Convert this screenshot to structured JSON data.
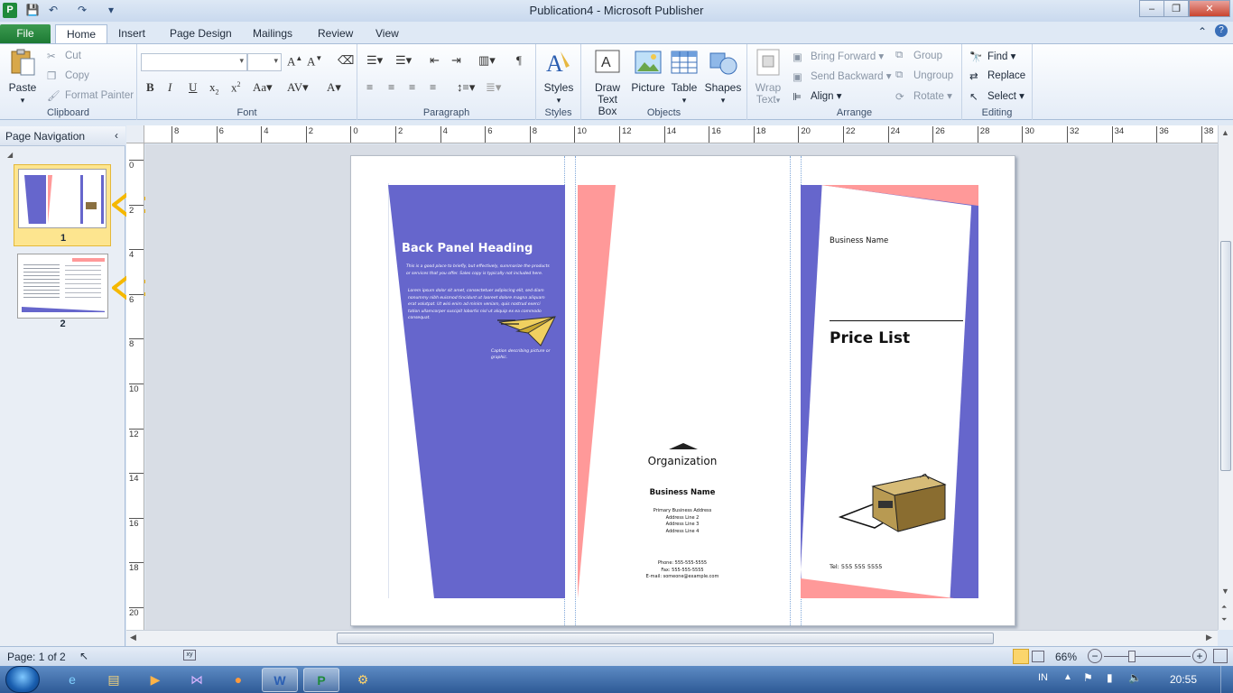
{
  "window": {
    "title": "Publication4  -  Microsoft Publisher",
    "min_label": "–",
    "max_label": "❐",
    "close_label": "✕"
  },
  "quick_access": {
    "save": "💾",
    "undo": "↶",
    "redo": "↷",
    "customize": "▾"
  },
  "tabs": [
    {
      "label": "File"
    },
    {
      "label": "Home"
    },
    {
      "label": "Insert"
    },
    {
      "label": "Page Design"
    },
    {
      "label": "Mailings"
    },
    {
      "label": "Review"
    },
    {
      "label": "View"
    }
  ],
  "ribbon": {
    "clipboard": {
      "label": "Clipboard",
      "paste": "Paste",
      "cut": "Cut",
      "copy": "Copy",
      "format_painter": "Format Painter"
    },
    "font": {
      "label": "Font"
    },
    "paragraph": {
      "label": "Paragraph"
    },
    "styles": {
      "label": "Styles",
      "styles_btn": "Styles"
    },
    "objects": {
      "label": "Objects",
      "draw_text_box_1": "Draw",
      "draw_text_box_2": "Text Box",
      "picture": "Picture",
      "table": "Table",
      "shapes": "Shapes"
    },
    "arrange": {
      "label": "Arrange",
      "wrap_text_1": "Wrap",
      "wrap_text_2": "Text",
      "bring_forward": "Bring Forward",
      "send_backward": "Send Backward",
      "align": "Align",
      "group": "Group",
      "ungroup": "Ungroup",
      "rotate": "Rotate"
    },
    "editing": {
      "label": "Editing",
      "find": "Find",
      "replace": "Replace",
      "select": "Select"
    }
  },
  "nav": {
    "title": "Page Navigation",
    "pages": [
      {
        "number": "1"
      },
      {
        "number": "2"
      }
    ]
  },
  "hruler_labels": [
    "8",
    "6",
    "4",
    "2",
    "0",
    "2",
    "4",
    "6",
    "8",
    "10",
    "12",
    "14",
    "16",
    "18",
    "20",
    "22",
    "24",
    "26",
    "28",
    "30",
    "32",
    "34",
    "36",
    "38"
  ],
  "vruler_labels": [
    "0",
    "2",
    "4",
    "6",
    "8",
    "10",
    "12",
    "14",
    "16",
    "18",
    "20"
  ],
  "publication": {
    "back_heading": "Back Panel Heading",
    "back_body_1": "This is a good place to briefly, but effectively, summarize the products or services that you offer. Sales copy is typically not included here.",
    "back_body_2": "Lorem ipsum dolor sit amet, consectetuer adipiscing elit, sed diam nonummy nibh euismod tincidunt ut laoreet dolore magna aliquam erat volutpat. Ut wisi enim ad minim veniam, quis nostrud exerci tation ullamcorper suscipit lobortis nisl ut aliquip ex ea commodo consequat.",
    "caption": "Caption describing picture or graphic.",
    "organization": "Organization",
    "business_name_mid": "Business Name",
    "address_1": "Primary Business Address",
    "address_2": "Address Line 2",
    "address_3": "Address Line 3",
    "address_4": "Address Line 4",
    "phone": "Phone: 555-555-5555",
    "fax": "Fax: 555-555-5555",
    "email": "E-mail: someone@example.com",
    "business_name_front": "Business Name",
    "price_list": "Price List",
    "tel": "Tel: 555 555 5555"
  },
  "status": {
    "page": "Page: 1 of 2",
    "zoom": "66%"
  },
  "tray": {
    "lang": "IN",
    "time": "20:55"
  },
  "colors": {
    "purple": "#6666cc",
    "pink": "#ff9999",
    "accent": "#ffb900"
  }
}
